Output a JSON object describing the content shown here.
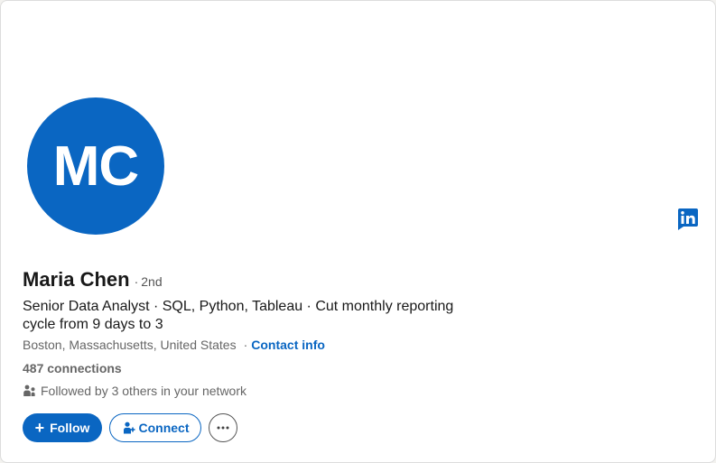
{
  "profile": {
    "initials": "MC",
    "name": "Maria Chen",
    "degree": "2nd",
    "headline": "Senior Data Analyst · SQL, Python, Tableau · Cut monthly reporting cycle from 9 days to 3",
    "location": "Boston, Massachusetts, United States",
    "contact_info_label": "Contact info",
    "connections": "487 connections",
    "followed_by": "Followed by 3 others in your network"
  },
  "actions": {
    "follow_label": "Follow",
    "connect_label": "Connect",
    "more_icon": "more-horizontal-icon"
  },
  "icons": {
    "brand_badge": "linkedin-icon",
    "followers": "people-icon",
    "connect": "person-add-icon"
  },
  "colors": {
    "brand": "#0a66c2",
    "text_primary": "#191919",
    "text_secondary": "#666666"
  }
}
